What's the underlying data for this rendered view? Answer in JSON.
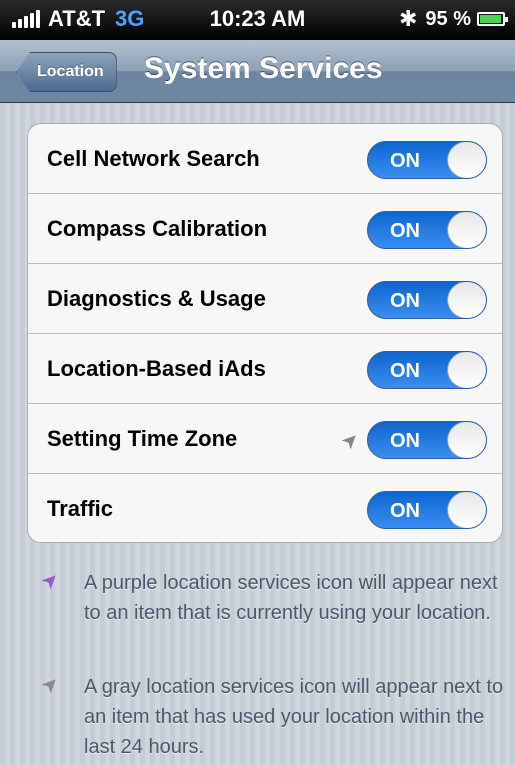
{
  "status_bar": {
    "carrier": "AT&T",
    "network": "3G",
    "time": "10:23 AM",
    "battery_percent": "95 %",
    "battery_level": 0.95
  },
  "nav": {
    "back_label": "Location",
    "title": "System Services"
  },
  "services": [
    {
      "label": "Cell Network Search",
      "toggle": "ON",
      "location_icon": false
    },
    {
      "label": "Compass Calibration",
      "toggle": "ON",
      "location_icon": false
    },
    {
      "label": "Diagnostics & Usage",
      "toggle": "ON",
      "location_icon": false
    },
    {
      "label": "Location-Based iAds",
      "toggle": "ON",
      "location_icon": false
    },
    {
      "label": "Setting Time Zone",
      "toggle": "ON",
      "location_icon": true
    },
    {
      "label": "Traffic",
      "toggle": "ON",
      "location_icon": false
    }
  ],
  "notes": [
    {
      "icon": "purple-location-arrow-icon",
      "color": "#9b59d0",
      "text": "A purple location services icon will appear next to an item that is currently using your location."
    },
    {
      "icon": "gray-location-arrow-icon",
      "color": "#8a8a8a",
      "text": "A gray location services icon will appear next to an item that has used your location within the last 24 hours."
    }
  ]
}
